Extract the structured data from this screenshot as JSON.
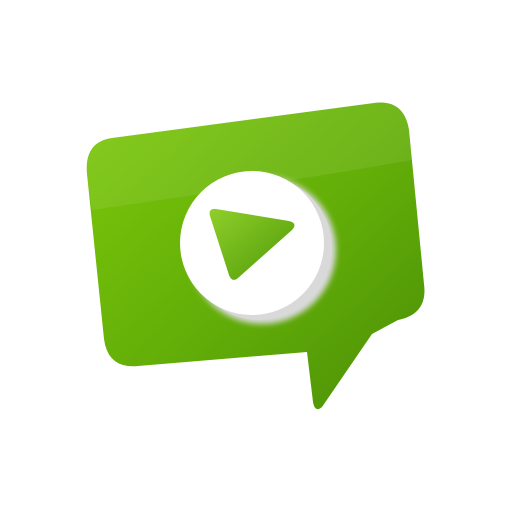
{
  "app_icon": {
    "icon_name": "video-chat-bubble-icon",
    "parts": {
      "bubble": "speech-bubble-icon",
      "disc": "play-disc-icon",
      "triangle": "play-triangle-icon"
    },
    "colors": {
      "background": "#ffffff",
      "bubble_light": "#7cc80a",
      "bubble_mid": "#62ad08",
      "bubble_dark": "#4b8f06",
      "disc": "#ffffff",
      "disc_shadow": "#d9d9d9",
      "triangle_light": "#8fcf2a",
      "triangle_dark": "#4f9a08"
    }
  }
}
